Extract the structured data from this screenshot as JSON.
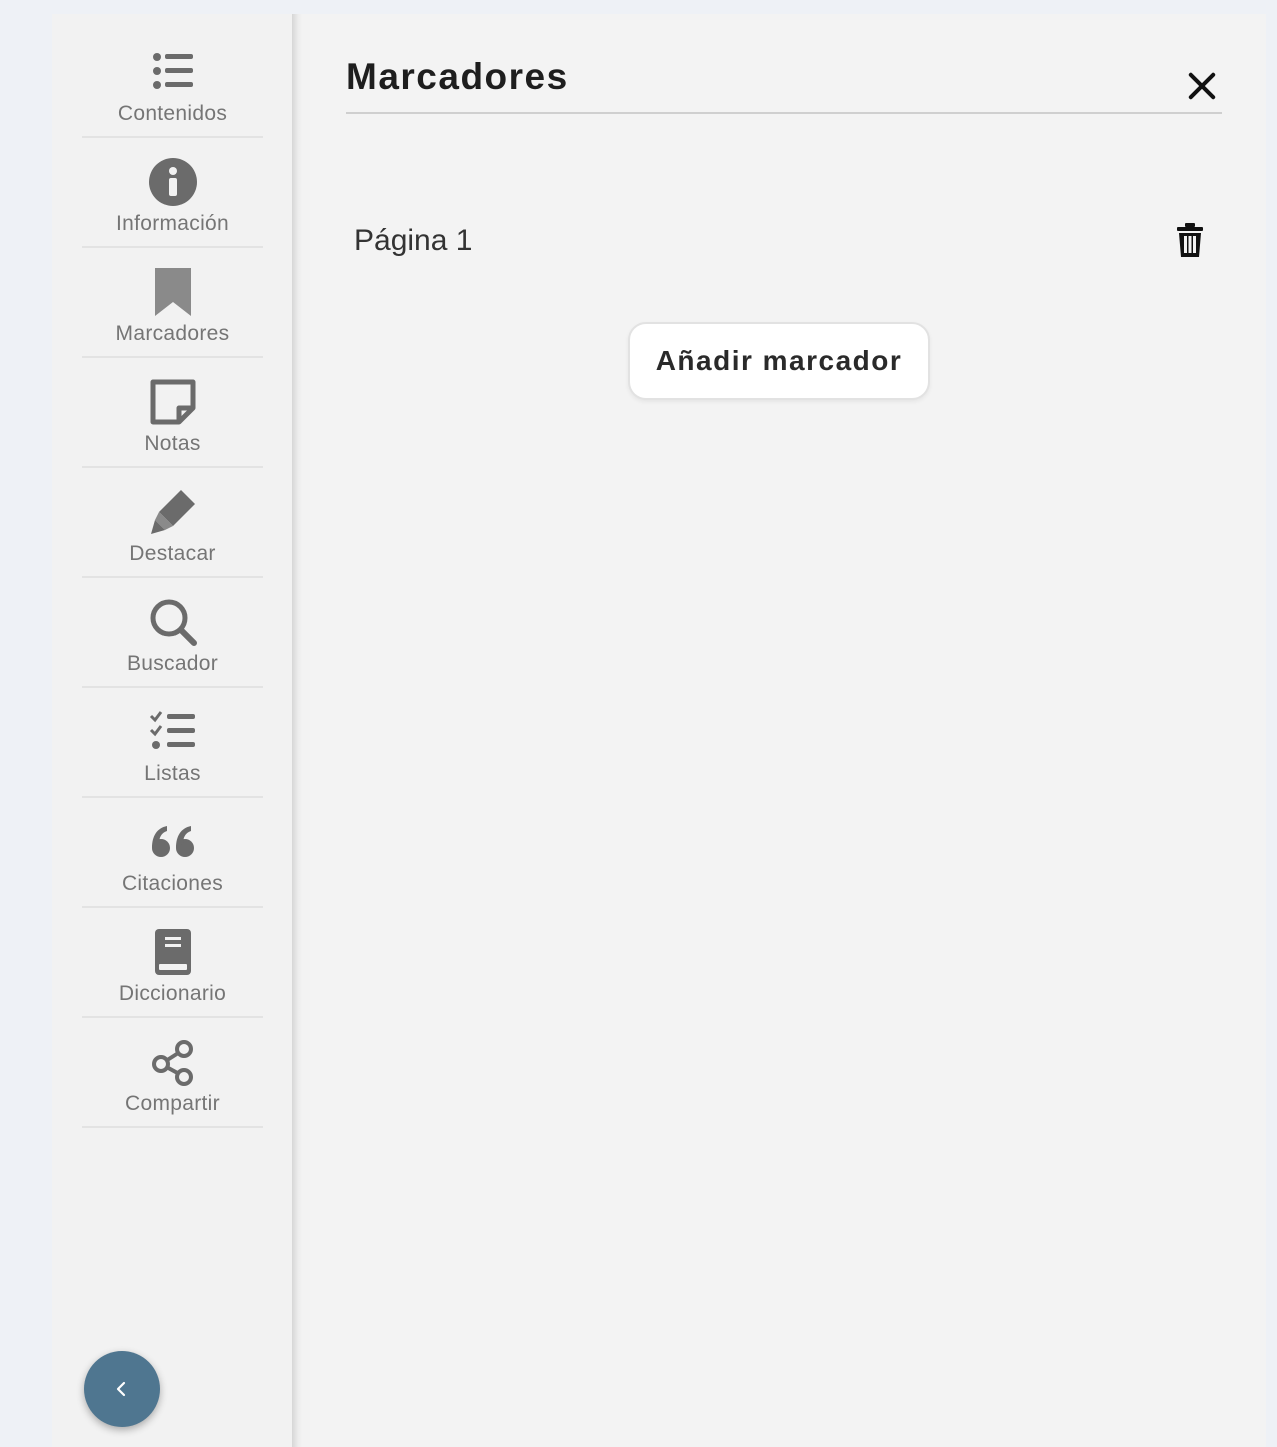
{
  "sidebar": {
    "items": [
      {
        "label": "Contenidos",
        "icon": "list-icon"
      },
      {
        "label": "Información",
        "icon": "info-icon"
      },
      {
        "label": "Marcadores",
        "icon": "bookmark-icon"
      },
      {
        "label": "Notas",
        "icon": "note-icon"
      },
      {
        "label": "Destacar",
        "icon": "highlighter-icon"
      },
      {
        "label": "Buscador",
        "icon": "search-icon"
      },
      {
        "label": "Listas",
        "icon": "checklist-icon"
      },
      {
        "label": "Citaciones",
        "icon": "quote-icon"
      },
      {
        "label": "Diccionario",
        "icon": "book-icon"
      },
      {
        "label": "Compartir",
        "icon": "share-icon"
      }
    ],
    "collapse_icon": "chevron-left-icon"
  },
  "panel": {
    "title": "Marcadores",
    "close_icon": "close-icon",
    "bookmarks": [
      {
        "label": "Página 1",
        "delete_icon": "trash-icon"
      }
    ],
    "add_button_label": "Añadir marcador"
  },
  "colors": {
    "icon_gray": "#6b6b6b",
    "label_gray": "#757575",
    "collapse_button": "#4f7690"
  }
}
